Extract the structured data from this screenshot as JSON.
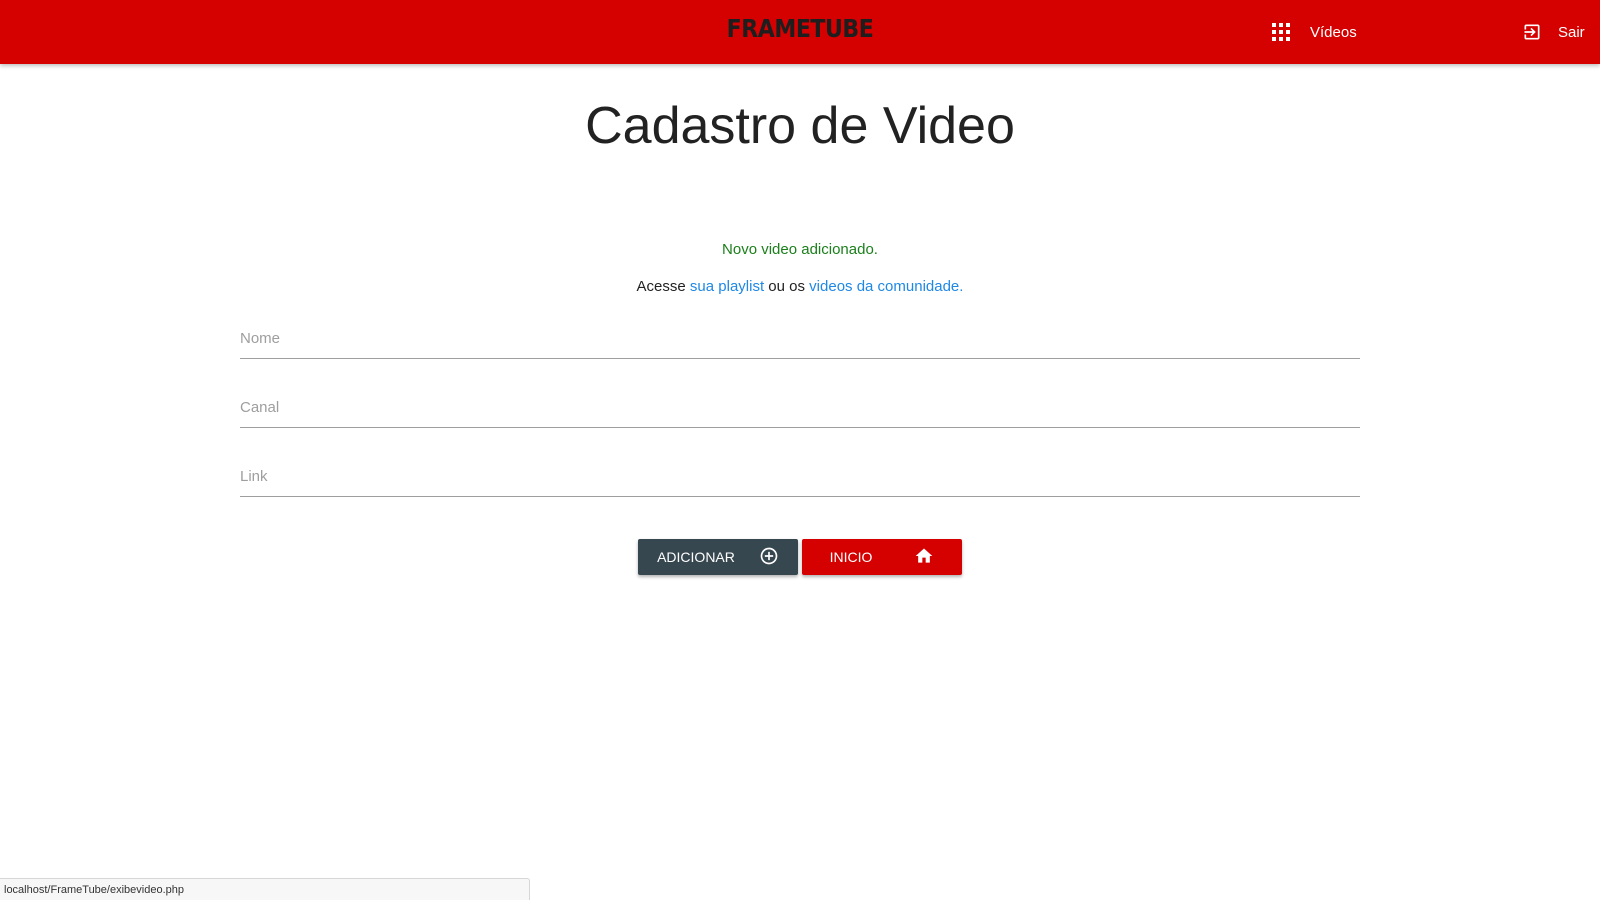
{
  "navbar": {
    "brand": "FRAMETUBE",
    "videos_label": "Vídeos",
    "logout_label": "Sair",
    "background_color": "#d50000",
    "videos_icon": "apps-grid-icon",
    "logout_icon": "exit-to-app-icon"
  },
  "main": {
    "title": "Cadastro de Video",
    "success_message": "Novo video adicionado.",
    "info": {
      "prefix": "Acesse",
      "playlist_link": "sua playlist",
      "middle": "ou os",
      "community_link": "videos da comunidade."
    },
    "form": {
      "nome_placeholder": "Nome",
      "canal_placeholder": "Canal",
      "link_placeholder": "Link"
    },
    "buttons": {
      "add_label": "ADICIONAR",
      "add_icon": "add-circle-outline-icon",
      "add_color": "#37474f",
      "home_label": "INICIO",
      "home_icon": "home-icon",
      "home_color": "#d50000"
    }
  },
  "status_bar": {
    "url": "localhost/FrameTube/exibevideo.php"
  }
}
